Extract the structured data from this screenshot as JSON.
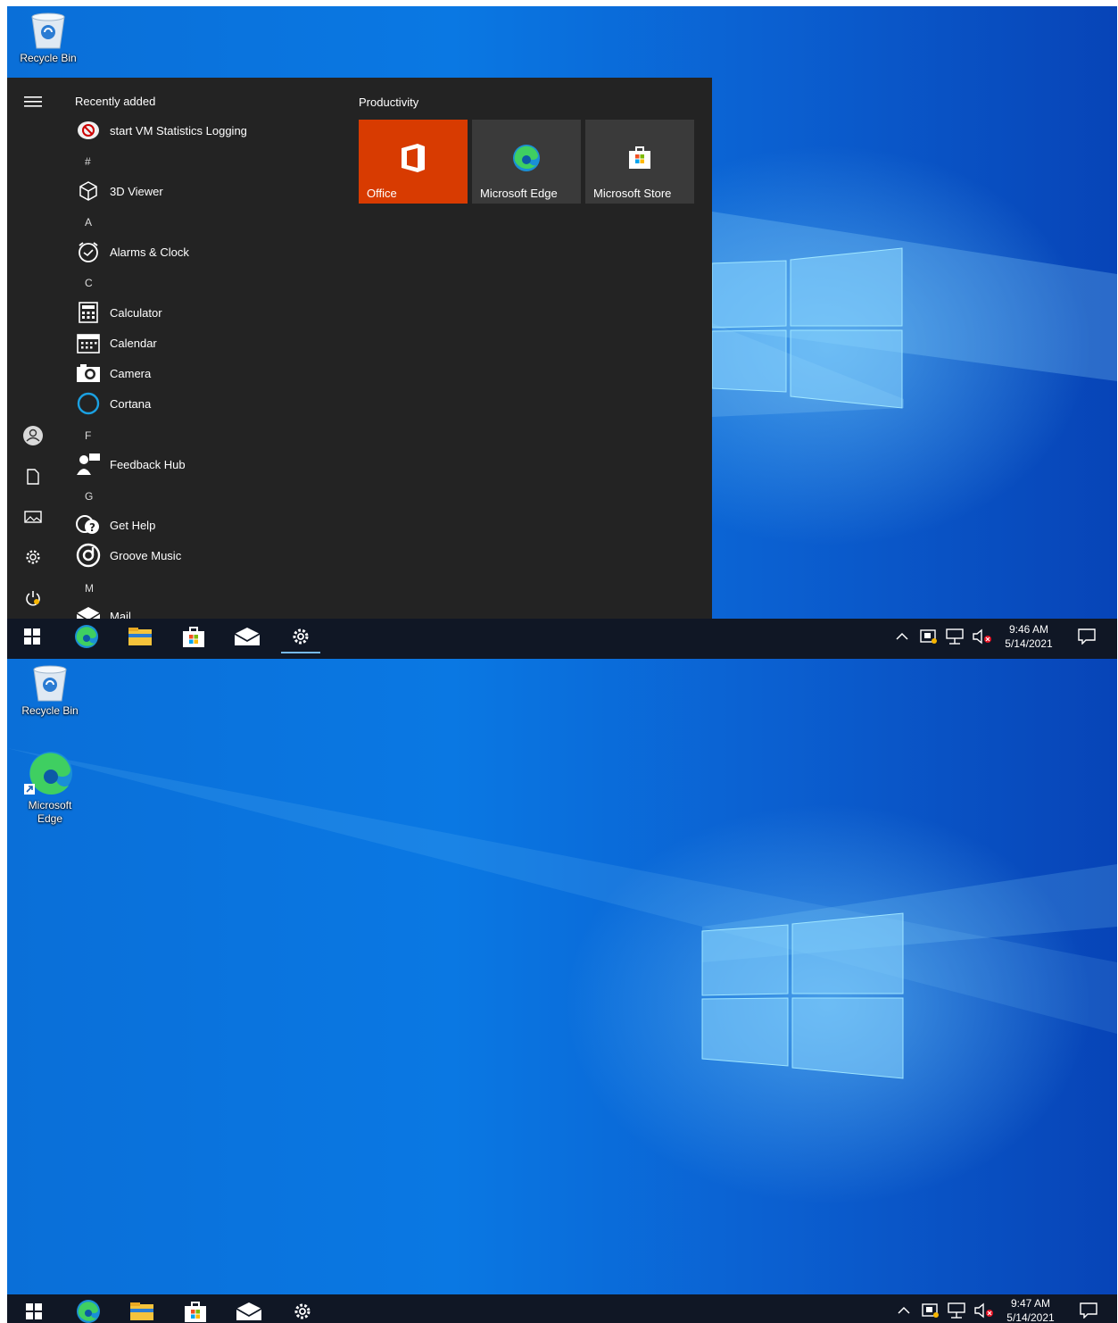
{
  "screen1": {
    "desktop": {
      "recycle_bin": "Recycle Bin"
    },
    "start_menu": {
      "recently_added_header": "Recently added",
      "recent_item": "start VM Statistics Logging",
      "groups": [
        {
          "letter": "#",
          "apps": [
            "3D Viewer"
          ]
        },
        {
          "letter": "A",
          "apps": [
            "Alarms & Clock"
          ]
        },
        {
          "letter": "C",
          "apps": [
            "Calculator",
            "Calendar",
            "Camera",
            "Cortana"
          ]
        },
        {
          "letter": "F",
          "apps": [
            "Feedback Hub"
          ]
        },
        {
          "letter": "G",
          "apps": [
            "Get Help",
            "Groove Music"
          ]
        },
        {
          "letter": "M",
          "apps": [
            "Mail"
          ]
        }
      ],
      "tiles_header": "Productivity",
      "tiles": [
        {
          "label": "Office",
          "color": "#d83b01"
        },
        {
          "label": "Microsoft Edge",
          "color": "#3a3a3a"
        },
        {
          "label": "Microsoft Store",
          "color": "#3a3a3a"
        }
      ]
    },
    "taskbar": {
      "time": "9:46 AM",
      "date": "5/14/2021"
    }
  },
  "screen2": {
    "desktop": {
      "recycle_bin": "Recycle Bin",
      "edge_line1": "Microsoft",
      "edge_line2": "Edge"
    },
    "taskbar": {
      "time": "9:47 AM",
      "date": "5/14/2021"
    }
  },
  "taskbar_icons": [
    "windows-start-icon",
    "edge-icon",
    "file-explorer-icon",
    "store-icon",
    "mail-icon",
    "settings-icon"
  ],
  "tray_icons": [
    "chevron-up-icon",
    "vm-tools-icon",
    "network-icon",
    "volume-muted-icon",
    "notification-icon"
  ],
  "colors": {
    "start_menu_bg": "#232323",
    "taskbar_bg": "#101725",
    "office_tile": "#d83b01",
    "wallpaper": "#0a78e3"
  }
}
